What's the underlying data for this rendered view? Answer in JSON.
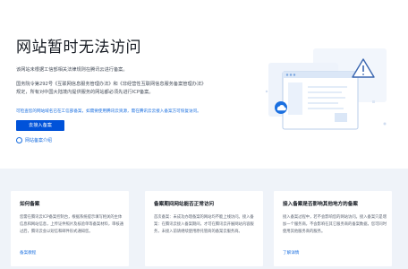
{
  "hero": {
    "title": "网站暂时无法访问",
    "line1": "该网站未根据工信部相关法律规则在腾讯云进行备案。",
    "line2": "国务院令第292号《互联网信息服务管理办法》和《非经营性互联网信息服务备案管理办法》",
    "line3": "规定，所有对中国大陆境内提供服务的网站都必须先进行ICP备案。",
    "hint": "可检查您的网站域名已在工信部备案，如需要使用腾讯云资源，需在腾讯云云接入备案方可恢复访问。",
    "cta_label": "去接入备案",
    "check_label": "网站备案介绍"
  },
  "cards": [
    {
      "title": "如何备案",
      "body": "您需在腾讯云ICP备案控制台，根据系统提示填写相关的主体信息和网站信息，上传证件照片及核验单等备案材料，审核通过后，腾讯云会以短信和邮件形式通知您。",
      "link": "备案教程"
    },
    {
      "title": "备案期间网站能否正常访问",
      "body": "首次备案：未成功办理备案的网站均不能上线访问。接入备案：在腾讯云接入备案期间，才可在腾讯云开展网站内容服务，未接入前请继续使用原托管商的备案云服务商。",
      "link": ""
    },
    {
      "title": "接入备案是否影响其他地方的备案",
      "body": "接入备案过程中，若不会影响您的网站访问。接入备案只是增加一个服务商，不会影响在其它服务商的备案数据，您可同时使用其他服务商的服务。",
      "link": "了解详情"
    }
  ],
  "colors": {
    "primary": "#0052d9",
    "link": "#1a6fe0",
    "bottom_bg": "#eff3f9"
  }
}
